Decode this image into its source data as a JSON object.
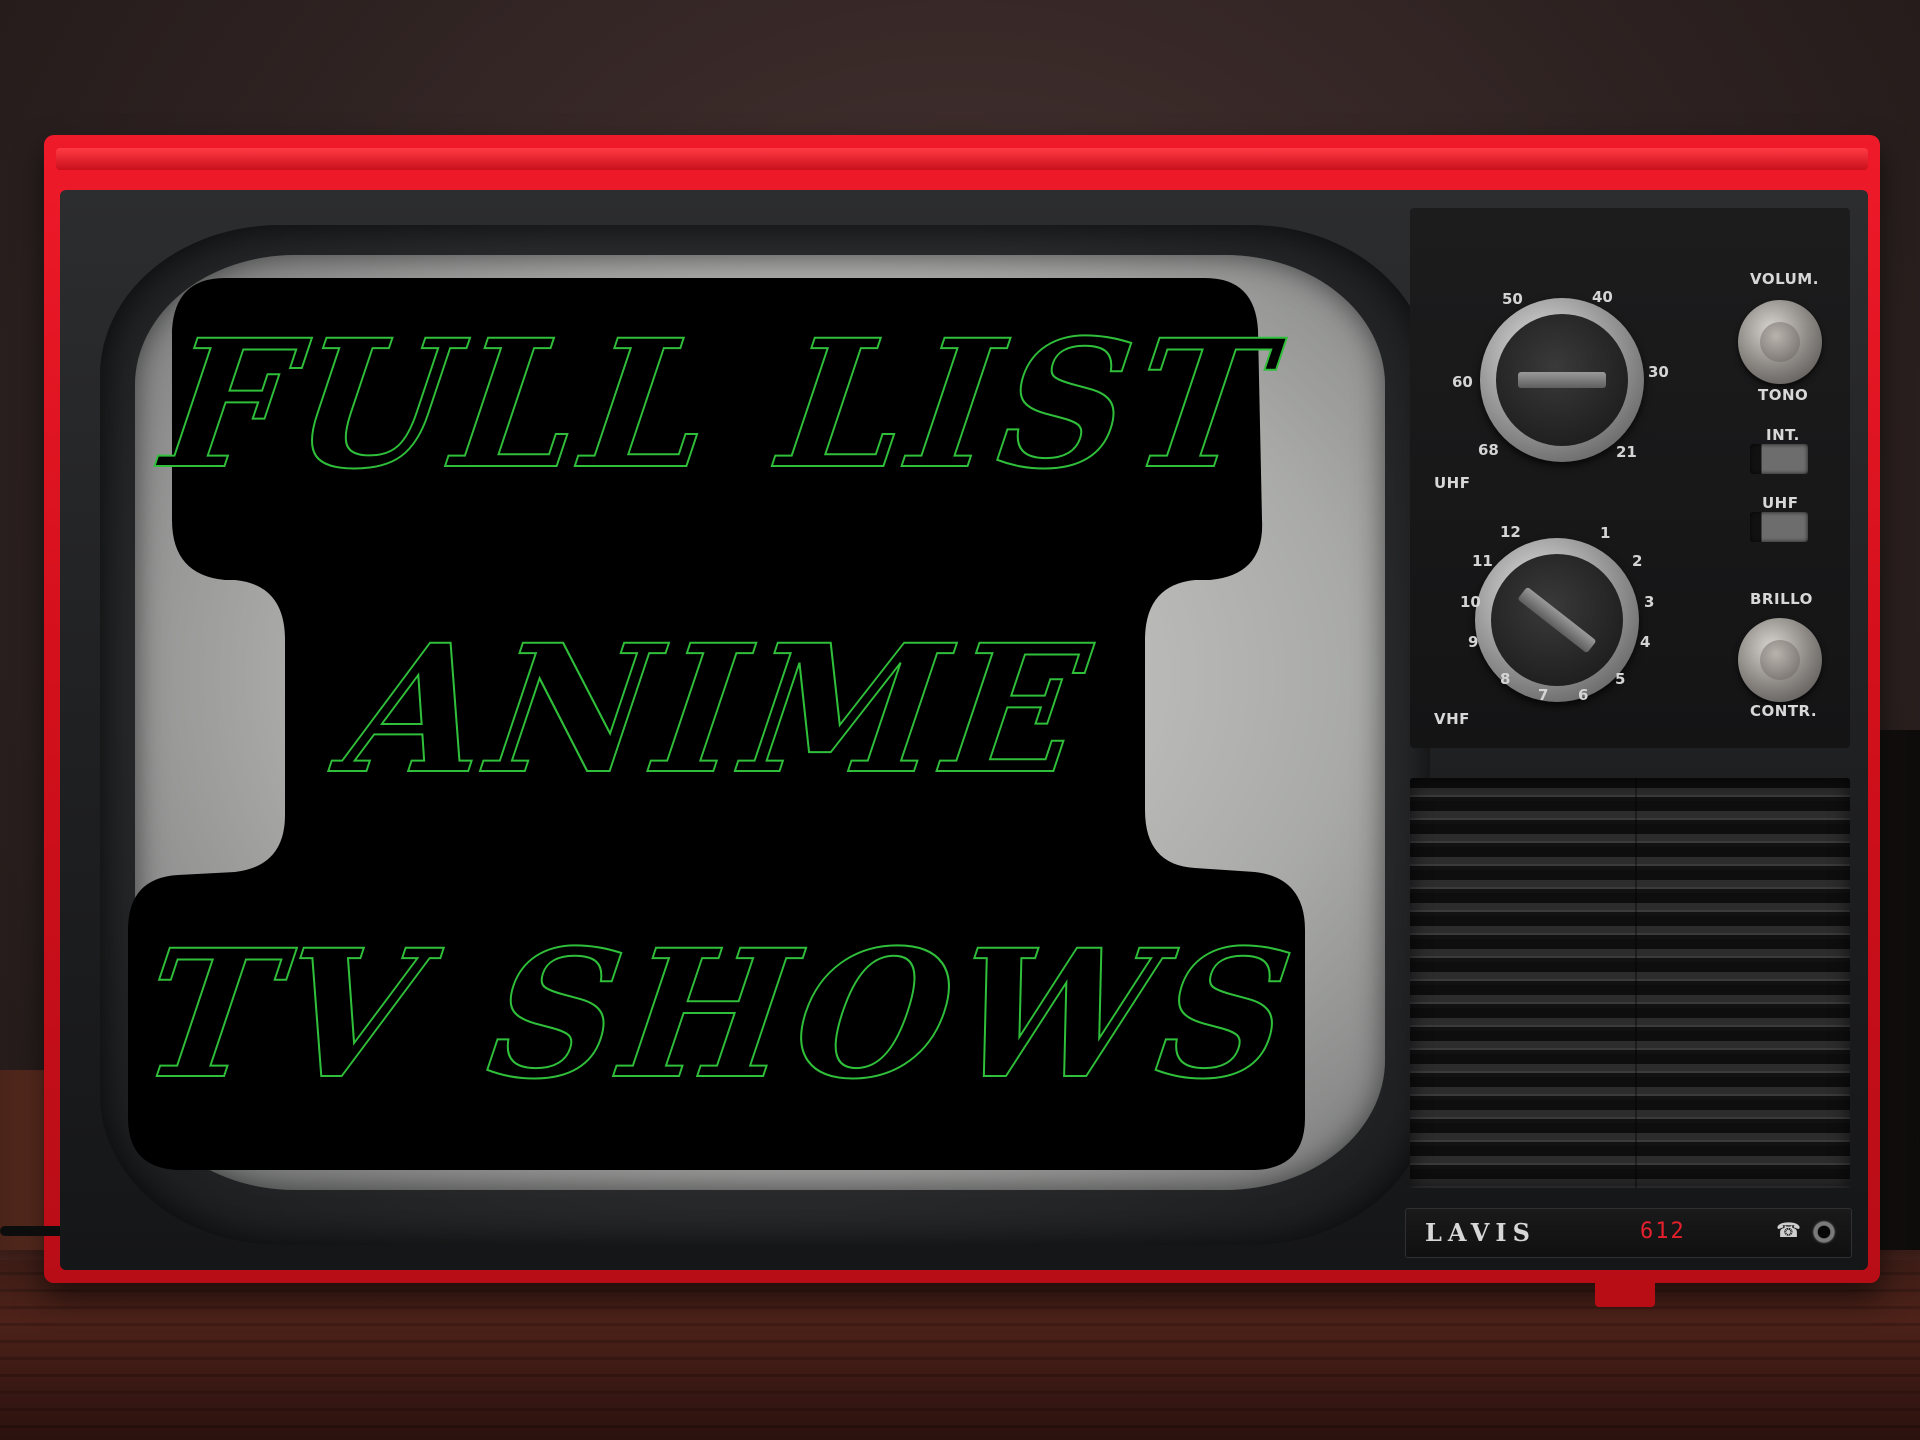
{
  "title_card": {
    "line1": "FULL LIST",
    "line2": "ANIME",
    "line3": "TV SHOWS",
    "text_color": "#000000",
    "outline_color": "#2fbf3a",
    "card_color": "#000000"
  },
  "tv": {
    "cabinet_color": "#d4101c",
    "brand": "LAVIS",
    "model": "612",
    "labels": {
      "volume": "VOLUM.",
      "tone": "TONO",
      "int": "INT.",
      "uhf_switch": "UHF",
      "brightness": "BRILLO",
      "contrast": "CONTR.",
      "uhf_band": "UHF",
      "vhf_band": "VHF"
    },
    "uhf_dial_numbers": [
      "50",
      "40",
      "30",
      "60",
      "68",
      "21"
    ],
    "vhf_dial_numbers": [
      "12",
      "1",
      "2",
      "3",
      "4",
      "5",
      "6",
      "7",
      "8",
      "9",
      "10",
      "11"
    ]
  }
}
